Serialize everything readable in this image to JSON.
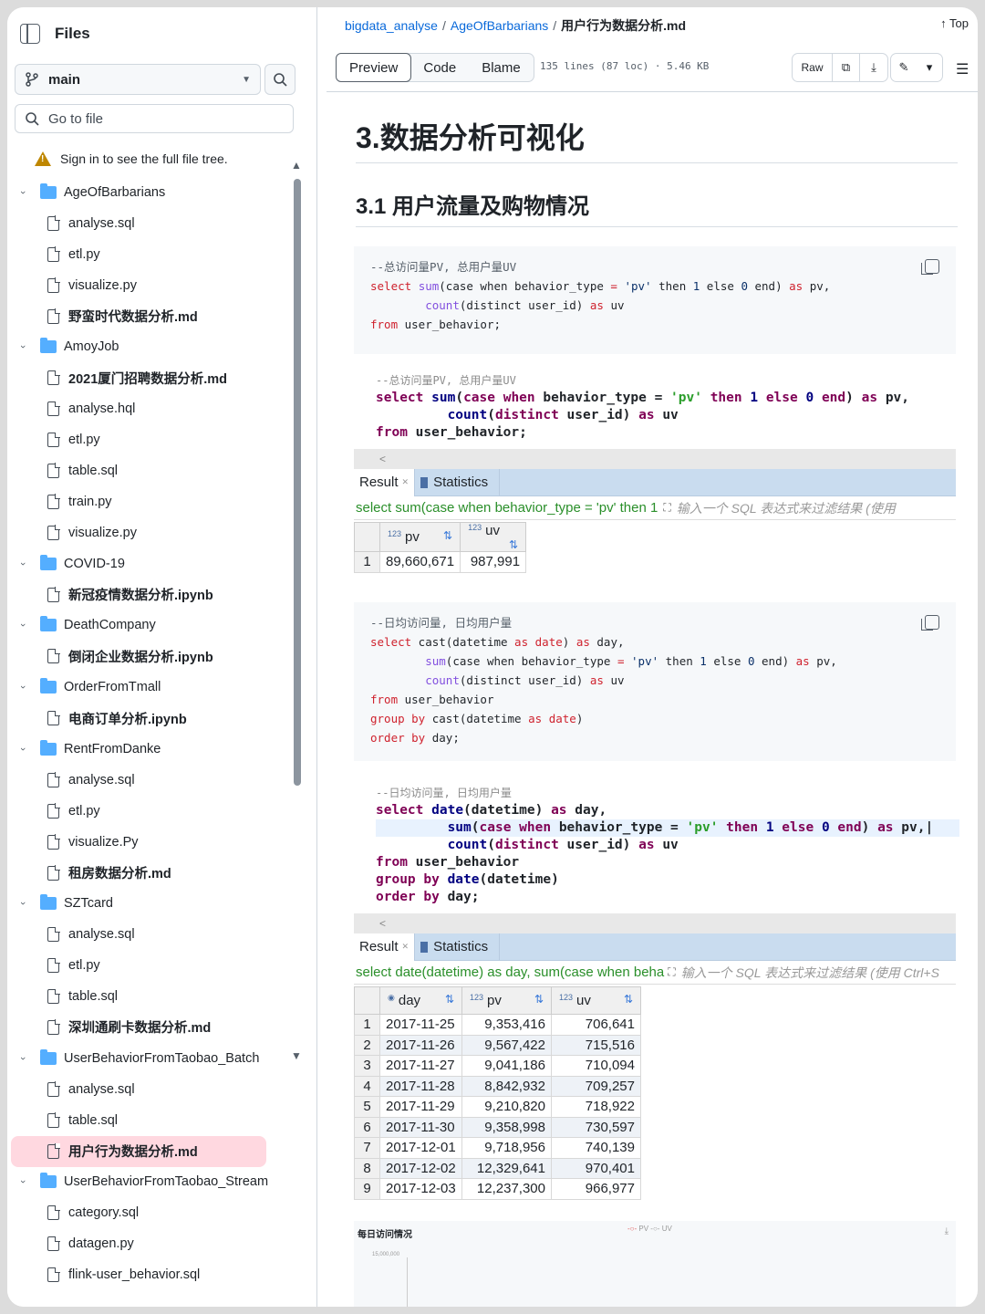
{
  "sidebar": {
    "title": "Files",
    "branch": "main",
    "goto_placeholder": "Go to file",
    "sign_in_note": "Sign in to see the full file tree.",
    "tree": [
      {
        "type": "folder",
        "label": "AgeOfBarbarians"
      },
      {
        "type": "file",
        "label": "analyse.sql"
      },
      {
        "type": "file",
        "label": "etl.py"
      },
      {
        "type": "file",
        "label": "visualize.py"
      },
      {
        "type": "file",
        "label": "野蛮时代数据分析.md",
        "bold": true
      },
      {
        "type": "folder",
        "label": "AmoyJob"
      },
      {
        "type": "file",
        "label": "2021厦门招聘数据分析.md",
        "bold": true
      },
      {
        "type": "file",
        "label": "analyse.hql"
      },
      {
        "type": "file",
        "label": "etl.py"
      },
      {
        "type": "file",
        "label": "table.sql"
      },
      {
        "type": "file",
        "label": "train.py"
      },
      {
        "type": "file",
        "label": "visualize.py"
      },
      {
        "type": "folder",
        "label": "COVID-19"
      },
      {
        "type": "file",
        "label": "新冠疫情数据分析.ipynb",
        "bold": true
      },
      {
        "type": "folder",
        "label": "DeathCompany"
      },
      {
        "type": "file",
        "label": "倒闭企业数据分析.ipynb",
        "bold": true
      },
      {
        "type": "folder",
        "label": "OrderFromTmall"
      },
      {
        "type": "file",
        "label": "电商订单分析.ipynb",
        "bold": true
      },
      {
        "type": "folder",
        "label": "RentFromDanke"
      },
      {
        "type": "file",
        "label": "analyse.sql"
      },
      {
        "type": "file",
        "label": "etl.py"
      },
      {
        "type": "file",
        "label": "visualize.Py"
      },
      {
        "type": "file",
        "label": "租房数据分析.md",
        "bold": true
      },
      {
        "type": "folder",
        "label": "SZTcard"
      },
      {
        "type": "file",
        "label": "analyse.sql"
      },
      {
        "type": "file",
        "label": "etl.py"
      },
      {
        "type": "file",
        "label": "table.sql"
      },
      {
        "type": "file",
        "label": "深圳通刷卡数据分析.md",
        "bold": true
      },
      {
        "type": "folder",
        "label": "UserBehaviorFromTaobao_Batch"
      },
      {
        "type": "file",
        "label": "analyse.sql"
      },
      {
        "type": "file",
        "label": "table.sql"
      },
      {
        "type": "file",
        "label": "用户行为数据分析.md",
        "bold": true,
        "selected": true
      },
      {
        "type": "folder",
        "label": "UserBehaviorFromTaobao_Stream"
      },
      {
        "type": "file",
        "label": "category.sql"
      },
      {
        "type": "file",
        "label": "datagen.py"
      },
      {
        "type": "file",
        "label": "flink-user_behavior.sql"
      }
    ]
  },
  "header": {
    "crumb_repo": "bigdata_analyse",
    "crumb_folder": "AgeOfBarbarians",
    "crumb_file": "用户行为数据分析.md",
    "top_label": "Top",
    "tab_preview": "Preview",
    "tab_code": "Code",
    "tab_blame": "Blame",
    "meta": "135 lines (87 loc) · 5.46 KB",
    "raw_label": "Raw"
  },
  "content": {
    "h1": "3.数据分析可视化",
    "h2": "3.1 用户流量及购物情况",
    "shot1": {
      "tab_result": "Result",
      "tab_stats": "Statistics",
      "filter_query": "select sum(case when behavior_type = 'pv' then 1",
      "filter_hint": "输入一个 SQL 表达式来过滤结果 (使用",
      "columns": [
        "pv",
        "uv"
      ],
      "rows": [
        [
          "1",
          "89,660,671",
          "987,991"
        ]
      ]
    },
    "shot2": {
      "tab_result": "Result",
      "tab_stats": "Statistics",
      "filter_query": "select date(datetime) as day, sum(case when beha",
      "filter_hint": "输入一个 SQL 表达式来过滤结果 (使用 Ctrl+S",
      "columns": [
        "day",
        "pv",
        "uv"
      ],
      "rows": [
        [
          "1",
          "2017-11-25",
          "9,353,416",
          "706,641"
        ],
        [
          "2",
          "2017-11-26",
          "9,567,422",
          "715,516"
        ],
        [
          "3",
          "2017-11-27",
          "9,041,186",
          "710,094"
        ],
        [
          "4",
          "2017-11-28",
          "8,842,932",
          "709,257"
        ],
        [
          "5",
          "2017-11-29",
          "9,210,820",
          "718,922"
        ],
        [
          "6",
          "2017-11-30",
          "9,358,998",
          "730,597"
        ],
        [
          "7",
          "2017-12-01",
          "9,718,956",
          "740,139"
        ],
        [
          "8",
          "2017-12-02",
          "12,329,641",
          "970,401"
        ],
        [
          "9",
          "2017-12-03",
          "12,237,300",
          "966,977"
        ]
      ]
    },
    "chart": {
      "title": "每日访问情况",
      "legend_pv": "PV",
      "legend_uv": "UV",
      "ytick": "15,000,000"
    }
  }
}
